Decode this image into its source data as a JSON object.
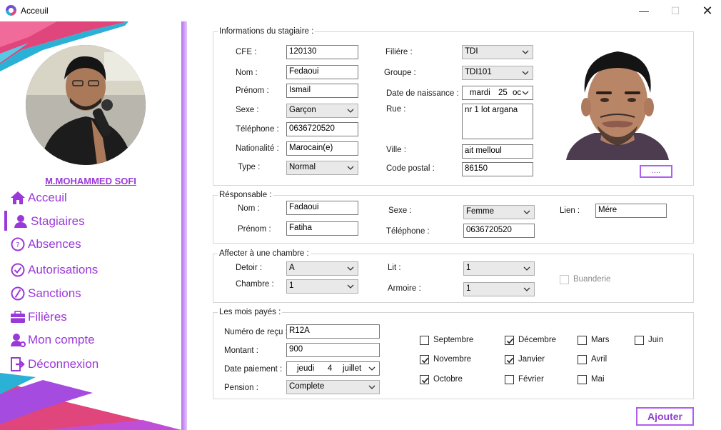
{
  "window": {
    "title": "Acceuil",
    "minimize": "—",
    "maximize": "☐",
    "close": "✕"
  },
  "sidebar": {
    "user_name": "M.MOHAMMED SOFI",
    "items": [
      {
        "label": "Acceuil",
        "icon": "home-icon"
      },
      {
        "label": "Stagiaires",
        "icon": "user-icon"
      },
      {
        "label": "Absences",
        "icon": "question-circle-icon"
      },
      {
        "label": "Autorisations",
        "icon": "check-circle-icon"
      },
      {
        "label": "Sanctions",
        "icon": "slash-circle-icon"
      },
      {
        "label": "Filières",
        "icon": "briefcase-icon"
      },
      {
        "label": "Mon compte",
        "icon": "user-gear-icon"
      },
      {
        "label": "Déconnexion",
        "icon": "logout-icon"
      }
    ],
    "active_item": "Stagiaires"
  },
  "stagiaire": {
    "title": "Informations du stagiaire :",
    "cfe_label": "CFE :",
    "cfe": "120130",
    "nom_label": "Nom :",
    "nom": "Fedaoui",
    "prenom_label": "Prénom :",
    "prenom": "Ismail",
    "sexe_label": "Sexe :",
    "sexe": "Garçon",
    "telephone_label": "Téléphone :",
    "telephone": "0636720520",
    "nationalite_label": "Nationalité :",
    "nationalite": "Marocain(e)",
    "type_label": "Type :",
    "type": "Normal",
    "filiere_label": "Filiére :",
    "filiere": "TDI",
    "groupe_label": "Groupe :",
    "groupe": "TDI101",
    "naissance_label": "Date de naissance :",
    "naissance_day": "mardi",
    "naissance_num": "25",
    "naissance_month": "oc",
    "rue_label": "Rue :",
    "rue": "nr 1 lot argana",
    "ville_label": "Ville :",
    "ville": "ait melloul",
    "code_postal_label": "Code postal :",
    "code_postal": "86150",
    "browse_button": "...."
  },
  "responsable": {
    "title": "Résponsable :",
    "nom_label": "Nom :",
    "nom": "Fadaoui",
    "prenom_label": "Prénom :",
    "prenom": "Fatiha",
    "sexe_label": "Sexe :",
    "sexe": "Femme",
    "telephone_label": "Téléphone :",
    "telephone": "0636720520",
    "lien_label": "Lien :",
    "lien": "Mére"
  },
  "chambre": {
    "title": "Affecter à une chambre :",
    "detoir_label": "Detoir :",
    "detoir": "A",
    "chambre_label": "Chambre :",
    "chambre": "1",
    "lit_label": "Lit :",
    "lit": "1",
    "armoire_label": "Armoire :",
    "armoire": "1",
    "buanderie_label": "Buanderie"
  },
  "paiement": {
    "title": "Les mois payés :",
    "recu_label": "Numéro de reçu :",
    "recu": "R12A",
    "montant_label": "Montant :",
    "montant": "900",
    "date_label": "Date paiement :",
    "date_day": "jeudi",
    "date_num": "4",
    "date_month": "juillet",
    "pension_label": "Pension :",
    "pension": "Complete",
    "months": [
      {
        "label": "Septembre",
        "checked": false
      },
      {
        "label": "Décembre",
        "checked": true
      },
      {
        "label": "Mars",
        "checked": false
      },
      {
        "label": "Juin",
        "checked": false
      },
      {
        "label": "Novembre",
        "checked": true
      },
      {
        "label": "Janvier",
        "checked": true
      },
      {
        "label": "Avril",
        "checked": false
      },
      {
        "label": "Octobre",
        "checked": true
      },
      {
        "label": "Février",
        "checked": false
      },
      {
        "label": "Mai",
        "checked": false
      }
    ]
  },
  "actions": {
    "add_button": "Ajouter"
  },
  "colors": {
    "accent": "#9b39d8",
    "accent_light": "#b05ef0",
    "deco_pink": "#e0457b",
    "deco_cyan": "#2bb0d6"
  }
}
